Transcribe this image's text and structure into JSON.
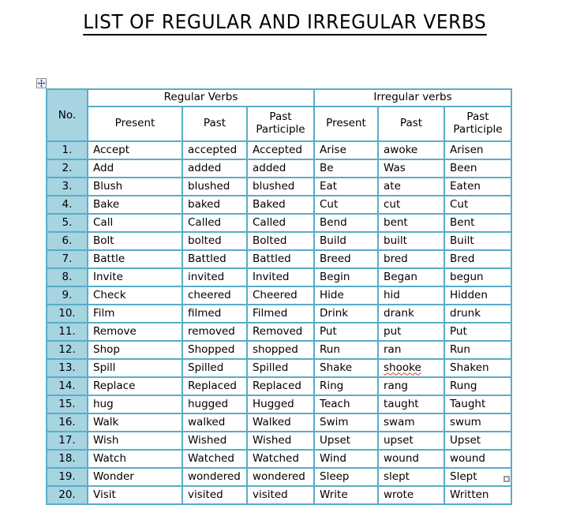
{
  "document": {
    "title": "LIST OF REGULAR AND IRREGULAR VERBS"
  },
  "handles": {
    "move_handle_icon": "move-four-arrows-icon",
    "resize_handle_icon": "resize-square-icon"
  },
  "colors": {
    "table_border": "#5aadc7",
    "number_column_fill": "#a6d4e1",
    "spellcheck_underline": "#e03a2f",
    "page_background": "#ffffff",
    "text": "#000000"
  },
  "table": {
    "group_headers": {
      "number": "No.",
      "regular": "Regular Verbs",
      "irregular": "Irregular verbs"
    },
    "sub_headers": {
      "present": "Present",
      "past": "Past",
      "past_participle_line1": "Past",
      "past_participle_line2": "Participle"
    },
    "columns": [
      "No.",
      "Present",
      "Past",
      "Past Participle",
      "Present",
      "Past",
      "Past Participle"
    ],
    "rows": [
      {
        "no": "1.",
        "r_present": "Accept",
        "r_past": "accepted",
        "r_pp": "Accepted",
        "i_present": "Arise",
        "i_past": "awoke",
        "i_pp": "Arisen",
        "misspelled": false
      },
      {
        "no": "2.",
        "r_present": "Add",
        "r_past": "added",
        "r_pp": "added",
        "i_present": "Be",
        "i_past": "Was",
        "i_pp": "Been",
        "misspelled": false
      },
      {
        "no": "3.",
        "r_present": "Blush",
        "r_past": "blushed",
        "r_pp": "blushed",
        "i_present": "Eat",
        "i_past": "ate",
        "i_pp": "Eaten",
        "misspelled": false
      },
      {
        "no": "4.",
        "r_present": "Bake",
        "r_past": "baked",
        "r_pp": "Baked",
        "i_present": "Cut",
        "i_past": "cut",
        "i_pp": "Cut",
        "misspelled": false
      },
      {
        "no": "5.",
        "r_present": "Call",
        "r_past": "Called",
        "r_pp": "Called",
        "i_present": "Bend",
        "i_past": "bent",
        "i_pp": "Bent",
        "misspelled": false
      },
      {
        "no": "6.",
        "r_present": "Bolt",
        "r_past": "bolted",
        "r_pp": "Bolted",
        "i_present": "Build",
        "i_past": "built",
        "i_pp": "Built",
        "misspelled": false
      },
      {
        "no": "7.",
        "r_present": "Battle",
        "r_past": "Battled",
        "r_pp": "Battled",
        "i_present": "Breed",
        "i_past": "bred",
        "i_pp": "Bred",
        "misspelled": false
      },
      {
        "no": "8.",
        "r_present": "Invite",
        "r_past": "invited",
        "r_pp": "Invited",
        "i_present": "Begin",
        "i_past": "Began",
        "i_pp": "begun",
        "misspelled": false
      },
      {
        "no": "9.",
        "r_present": "Check",
        "r_past": "cheered",
        "r_pp": "Cheered",
        "i_present": "Hide",
        "i_past": "hid",
        "i_pp": "Hidden",
        "misspelled": false
      },
      {
        "no": "10.",
        "r_present": "Film",
        "r_past": "filmed",
        "r_pp": "Filmed",
        "i_present": "Drink",
        "i_past": "drank",
        "i_pp": "drunk",
        "misspelled": false
      },
      {
        "no": "11.",
        "r_present": "Remove",
        "r_past": "removed",
        "r_pp": "Removed",
        "i_present": "Put",
        "i_past": "put",
        "i_pp": "Put",
        "misspelled": false
      },
      {
        "no": "12.",
        "r_present": "Shop",
        "r_past": "Shopped",
        "r_pp": "shopped",
        "i_present": "Run",
        "i_past": "ran",
        "i_pp": "Run",
        "misspelled": false
      },
      {
        "no": "13.",
        "r_present": "Spill",
        "r_past": "Spilled",
        "r_pp": "Spilled",
        "i_present": "Shake",
        "i_past": "shooke",
        "i_pp": "Shaken",
        "misspelled": true
      },
      {
        "no": "14.",
        "r_present": "Replace",
        "r_past": "Replaced",
        "r_pp": "Replaced",
        "i_present": "Ring",
        "i_past": "rang",
        "i_pp": "Rung",
        "misspelled": false
      },
      {
        "no": "15.",
        "r_present": "hug",
        "r_past": "hugged",
        "r_pp": "Hugged",
        "i_present": "Teach",
        "i_past": "taught",
        "i_pp": "Taught",
        "misspelled": false
      },
      {
        "no": "16.",
        "r_present": "Walk",
        "r_past": "walked",
        "r_pp": "Walked",
        "i_present": "Swim",
        "i_past": "swam",
        "i_pp": "swum",
        "misspelled": false
      },
      {
        "no": "17.",
        "r_present": "Wish",
        "r_past": "Wished",
        "r_pp": "Wished",
        "i_present": "Upset",
        "i_past": "upset",
        "i_pp": "Upset",
        "misspelled": false
      },
      {
        "no": "18.",
        "r_present": "Watch",
        "r_past": "Watched",
        "r_pp": "Watched",
        "i_present": "Wind",
        "i_past": "wound",
        "i_pp": "wound",
        "misspelled": false
      },
      {
        "no": "19.",
        "r_present": "Wonder",
        "r_past": "wondered",
        "r_pp": "wondered",
        "i_present": "Sleep",
        "i_past": "slept",
        "i_pp": "Slept",
        "misspelled": false
      },
      {
        "no": "20.",
        "r_present": "Visit",
        "r_past": "visited",
        "r_pp": "visited",
        "i_present": "Write",
        "i_past": "wrote",
        "i_pp": "Written",
        "misspelled": false
      }
    ]
  }
}
